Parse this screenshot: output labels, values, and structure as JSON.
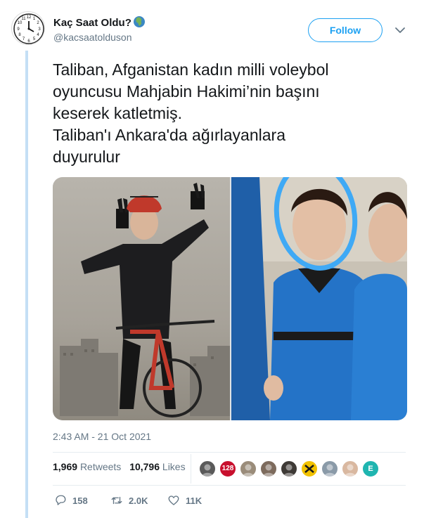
{
  "tweet": {
    "author_name": "Kaç Saat Oldu?",
    "author_emoji_icon": "globe-africa-icon",
    "author_handle": "@kacsaatolduson",
    "follow_label": "Follow",
    "text": "Taliban, Afganistan kadın milli voleybol\noyuncusu Mahjabin Hakimi’nin başını\nkeserek katletmiş.\nTaliban'ı Ankara'da ağırlayanlara\nduyurulur",
    "timestamp": "2:43 AM - 21 Oct 2021"
  },
  "stats": {
    "retweets_count": "1,969",
    "retweets_label": "Retweets",
    "likes_count": "10,796",
    "likes_label": "Likes"
  },
  "likers": [
    {
      "icon": "avatar-photo",
      "color": "#5a5a5a",
      "text": ""
    },
    {
      "icon": "avatar-badge",
      "color": "#c8102e",
      "text": "128"
    },
    {
      "icon": "avatar-photo",
      "color": "#9a8c7a",
      "text": ""
    },
    {
      "icon": "avatar-photo",
      "color": "#7d6b5d",
      "text": ""
    },
    {
      "icon": "avatar-photo",
      "color": "#3e3a36",
      "text": ""
    },
    {
      "icon": "avatar-logo",
      "color": "#f2c200",
      "text": ""
    },
    {
      "icon": "avatar-photo",
      "color": "#8a9aa8",
      "text": ""
    },
    {
      "icon": "avatar-photo",
      "color": "#d9b8a0",
      "text": ""
    },
    {
      "icon": "avatar-letter",
      "color": "#1fb5b0",
      "text": "E"
    }
  ],
  "actions": {
    "reply_count": "158",
    "retweet_count": "2.0K",
    "like_count": "11K"
  },
  "colors": {
    "accent": "#1da1f2",
    "secondary_text": "#657786",
    "thread_line": "#c4dff5"
  }
}
